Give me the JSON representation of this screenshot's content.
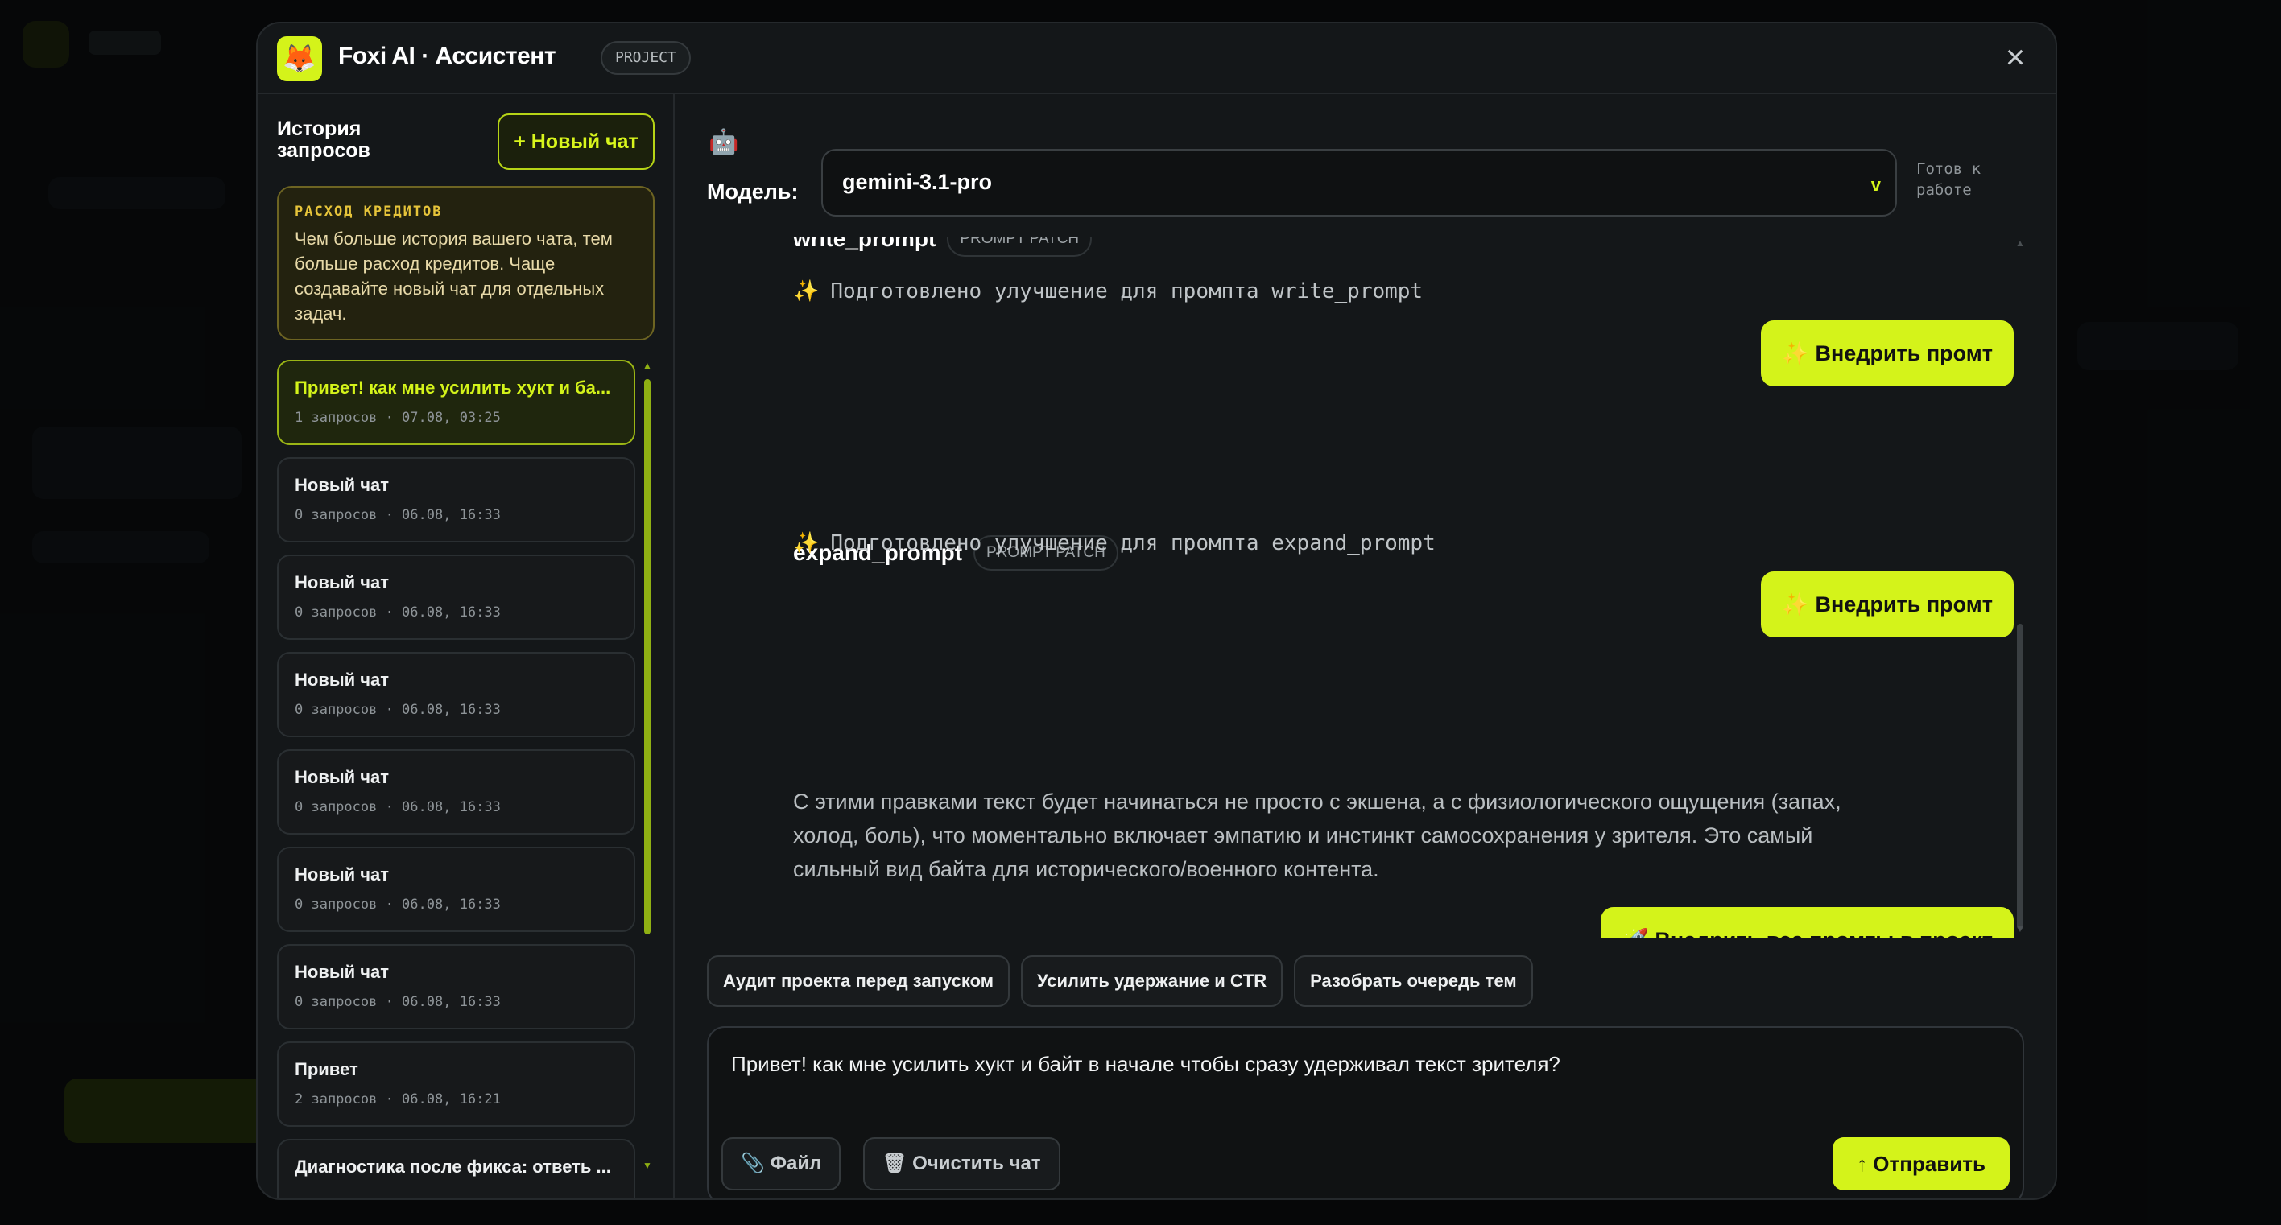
{
  "header": {
    "logo_emoji": "🦊",
    "title": "Foxi AI · Ассистент",
    "badge": "PROJECT",
    "close_label": "×"
  },
  "sidebar": {
    "title": "История запросов",
    "new_chat_label": "+ Новый чат",
    "credit_notice": {
      "title": "РАСХОД КРЕДИТОВ",
      "text": "Чем больше история вашего чата, тем больше расход кредитов. Чаще создавайте новый чат для отдельных задач."
    },
    "chats": [
      {
        "title": "Привет! как мне усилить хукт и ба...",
        "meta": "1 запросов · 07.08, 03:25",
        "active": true
      },
      {
        "title": "Новый чат",
        "meta": "0 запросов · 06.08, 16:33"
      },
      {
        "title": "Новый чат",
        "meta": "0 запросов · 06.08, 16:33"
      },
      {
        "title": "Новый чат",
        "meta": "0 запросов · 06.08, 16:33"
      },
      {
        "title": "Новый чат",
        "meta": "0 запросов · 06.08, 16:33"
      },
      {
        "title": "Новый чат",
        "meta": "0 запросов · 06.08, 16:33"
      },
      {
        "title": "Новый чат",
        "meta": "0 запросов · 06.08, 16:33"
      },
      {
        "title": "Привет",
        "meta": "2 запросов · 06.08, 16:21"
      },
      {
        "title": "Диагностика после фикса: ответь ...",
        "meta": ""
      }
    ]
  },
  "model": {
    "icon": "🤖",
    "label": "Модель:",
    "value": "gemini-3.1-pro",
    "chevron": "v",
    "status": "Готов к работе"
  },
  "messages": {
    "patches": [
      {
        "name": "write_prompt",
        "tag": "PROMPT PATCH",
        "spark": "✨",
        "text": "Подготовлено улучшение для промпта write_prompt",
        "button": "✨  Внедрить промт"
      },
      {
        "name": "expand_prompt",
        "tag": "PROMPT PATCH",
        "spark": "✨",
        "text": "Подготовлено улучшение для промпта expand_prompt",
        "button": "✨  Внедрить промт"
      }
    ],
    "final_text": "С этими правками текст будет начинаться не просто с экшена, а с физиологического ощущения (запах, холод, боль), что моментально включает эмпатию и инстинкт самосохранения у зрителя. Это самый сильный вид байта для исторического/военного контента.",
    "apply_all": "🚀 Внедрить все промты в проект"
  },
  "quick_actions": [
    "Аудит проекта перед запуском",
    "Усилить удержание и CTR",
    "Разобрать очередь тем"
  ],
  "composer": {
    "value": "Привет! как мне усилить хукт и байт в начале чтобы сразу удерживал текст зрителя?",
    "file_label": "📎 Файл",
    "clear_label": "🗑 Очистить чат",
    "send_label": "↑ Отправить"
  },
  "colors": {
    "accent": "#d4f31a",
    "panel": "#141719",
    "warning_bg": "#23220f"
  }
}
